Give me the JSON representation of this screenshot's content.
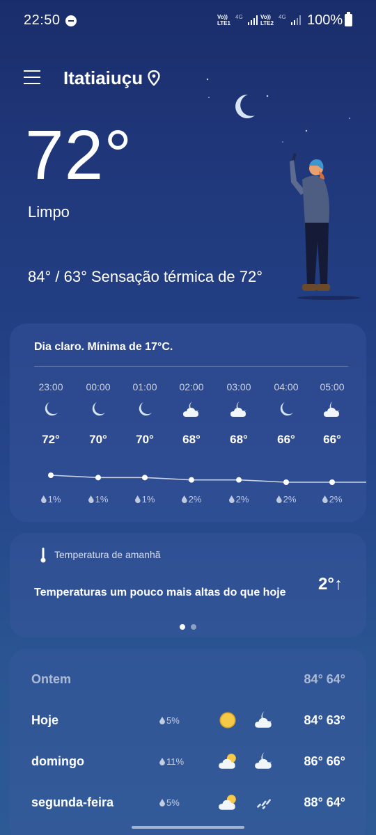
{
  "status_bar": {
    "time": "22:50",
    "sim1_label": "Vo)) LTE1",
    "sim2_label": "Vo)) LTE2",
    "network": "4G",
    "battery": "100%"
  },
  "header": {
    "location": "Itatiaiuçu"
  },
  "current": {
    "temperature": "72°",
    "condition": "Limpo",
    "hi_lo_feels": "84° / 63° Sensação térmica de 72°"
  },
  "hourly": {
    "summary": "Dia claro. Mínima de 17°C.",
    "hours": [
      {
        "time": "23:00",
        "icon": "moon-icon",
        "temp": "72°",
        "temp_value": 72,
        "precip": "1%"
      },
      {
        "time": "00:00",
        "icon": "moon-icon",
        "temp": "70°",
        "temp_value": 70,
        "precip": "1%"
      },
      {
        "time": "01:00",
        "icon": "moon-icon",
        "temp": "70°",
        "temp_value": 70,
        "precip": "1%"
      },
      {
        "time": "02:00",
        "icon": "moon-cloud-icon",
        "temp": "68°",
        "temp_value": 68,
        "precip": "2%"
      },
      {
        "time": "03:00",
        "icon": "moon-cloud-icon",
        "temp": "68°",
        "temp_value": 68,
        "precip": "2%"
      },
      {
        "time": "04:00",
        "icon": "moon-icon",
        "temp": "66°",
        "temp_value": 66,
        "precip": "2%"
      },
      {
        "time": "05:00",
        "icon": "moon-cloud-icon",
        "temp": "66°",
        "temp_value": 66,
        "precip": "2%"
      }
    ]
  },
  "tomorrow": {
    "label": "Temperatura de amanhã",
    "text": "Temperaturas um pouco mais altas do que hoje",
    "delta": "2°↑"
  },
  "daily": {
    "yesterday": {
      "name": "Ontem",
      "temps": "84° 64°"
    },
    "days": [
      {
        "name": "Hoje",
        "precip": "5%",
        "day_icon": "sun-icon",
        "night_icon": "moon-cloud-icon",
        "temps": "84° 63°"
      },
      {
        "name": "domingo",
        "precip": "11%",
        "day_icon": "sun-cloud-icon",
        "night_icon": "moon-cloud-icon",
        "temps": "86° 66°"
      },
      {
        "name": "segunda-feira",
        "precip": "5%",
        "day_icon": "sun-cloud-icon",
        "night_icon": "rain-icon",
        "temps": "88° 64°"
      }
    ]
  }
}
